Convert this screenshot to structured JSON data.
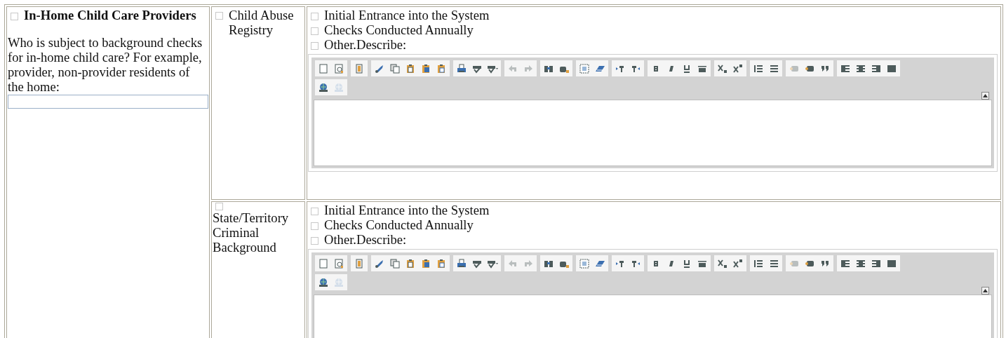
{
  "section": {
    "checked": false,
    "title": "In-Home Child Care Providers",
    "question": "Who is subject to background checks for in-home child care? For example, provider, non-provider residents of the home:"
  },
  "rows": [
    {
      "checked": false,
      "label": "Child Abuse Registry",
      "options": [
        {
          "label": "Initial Entrance into the System",
          "checked": false
        },
        {
          "label": "Checks Conducted Annually",
          "checked": false
        },
        {
          "label": "Other.Describe:",
          "checked": false
        }
      ],
      "editor": {
        "toolbar": [
          [
            [
              {
                "disabled": false
              },
              {
                "disabled": false
              }
            ],
            [
              {
                "disabled": false
              }
            ],
            [
              {
                "disabled": false
              },
              {
                "disabled": false
              },
              {
                "disabled": false
              },
              {
                "disabled": false
              },
              {
                "disabled": false
              }
            ],
            [
              {
                "disabled": false
              },
              {
                "disabled": false
              },
              {
                "disabled": false
              }
            ],
            [
              {
                "disabled": true
              },
              {
                "disabled": true
              }
            ],
            [
              {
                "disabled": false
              },
              {
                "disabled": false
              }
            ],
            [
              {
                "disabled": false
              },
              {
                "disabled": false
              }
            ],
            [
              {
                "disabled": false
              },
              {
                "disabled": false
              }
            ],
            [
              {
                "disabled": false
              },
              {
                "disabled": false
              },
              {
                "disabled": false
              },
              {
                "disabled": false
              }
            ],
            [
              {
                "disabled": false
              },
              {
                "disabled": false
              }
            ],
            [
              {
                "disabled": false
              },
              {
                "disabled": false
              }
            ],
            [
              {
                "disabled": true
              },
              {
                "disabled": false
              },
              {
                "disabled": false
              }
            ],
            [
              {
                "disabled": false
              },
              {
                "disabled": false
              },
              {
                "disabled": false
              },
              {
                "disabled": false
              }
            ]
          ],
          [
            [
              {
                "disabled": false
              },
              {
                "disabled": true
              }
            ]
          ]
        ]
      }
    },
    {
      "checked": false,
      "label": "State/Territory Criminal Background",
      "options": [
        {
          "label": "Initial Entrance into the System",
          "checked": false
        },
        {
          "label": "Checks Conducted Annually",
          "checked": false
        },
        {
          "label": "Other.Describe:",
          "checked": false
        }
      ],
      "editor": {
        "toolbar": [
          [
            [
              {
                "disabled": false
              },
              {
                "disabled": false
              }
            ],
            [
              {
                "disabled": false
              }
            ],
            [
              {
                "disabled": false
              },
              {
                "disabled": false
              },
              {
                "disabled": false
              },
              {
                "disabled": false
              },
              {
                "disabled": false
              }
            ],
            [
              {
                "disabled": false
              },
              {
                "disabled": false
              },
              {
                "disabled": false
              }
            ],
            [
              {
                "disabled": true
              },
              {
                "disabled": true
              }
            ],
            [
              {
                "disabled": false
              },
              {
                "disabled": false
              }
            ],
            [
              {
                "disabled": false
              },
              {
                "disabled": false
              }
            ],
            [
              {
                "disabled": false
              },
              {
                "disabled": false
              }
            ],
            [
              {
                "disabled": false
              },
              {
                "disabled": false
              },
              {
                "disabled": false
              },
              {
                "disabled": false
              }
            ],
            [
              {
                "disabled": false
              },
              {
                "disabled": false
              }
            ],
            [
              {
                "disabled": false
              },
              {
                "disabled": false
              }
            ],
            [
              {
                "disabled": true
              },
              {
                "disabled": false
              },
              {
                "disabled": false
              }
            ],
            [
              {
                "disabled": false
              },
              {
                "disabled": false
              },
              {
                "disabled": false
              },
              {
                "disabled": false
              }
            ]
          ],
          [
            [
              {
                "disabled": false
              },
              {
                "disabled": true
              }
            ]
          ]
        ]
      }
    }
  ]
}
